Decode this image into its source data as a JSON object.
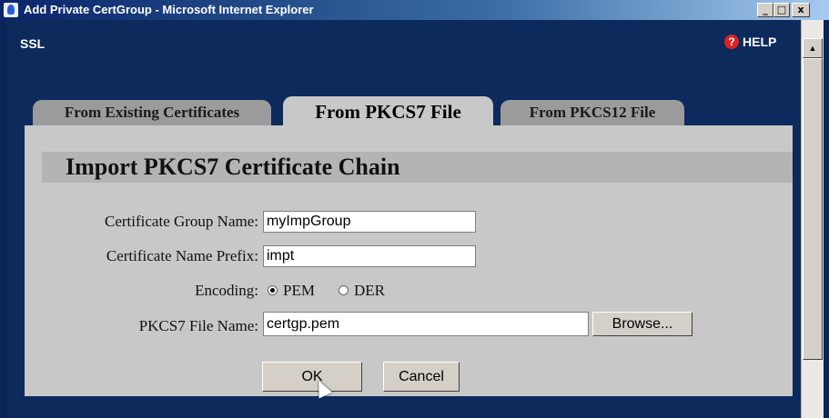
{
  "window": {
    "title": "Add Private CertGroup - Microsoft Internet Explorer",
    "controls": {
      "minimize": "_",
      "maximize": "□",
      "close": "x"
    }
  },
  "header": {
    "section": "SSL",
    "help": "HELP"
  },
  "tabs": [
    {
      "label": "From Existing Certificates",
      "active": false
    },
    {
      "label": "From PKCS7 File",
      "active": true
    },
    {
      "label": "From PKCS12 File",
      "active": false
    }
  ],
  "panel": {
    "title": "Import PKCS7 Certificate Chain",
    "fields": {
      "group_name": {
        "label": "Certificate Group Name:",
        "value": "myImpGroup"
      },
      "name_prefix": {
        "label": "Certificate Name Prefix:",
        "value": "impt"
      },
      "encoding": {
        "label": "Encoding:",
        "options": [
          "PEM",
          "DER"
        ],
        "selected": "PEM"
      },
      "file_name": {
        "label": "PKCS7 File Name:",
        "value": "certgp.pem",
        "browse": "Browse..."
      }
    },
    "buttons": {
      "ok": "OK",
      "cancel": "Cancel"
    }
  },
  "icons": {
    "help": "help-icon",
    "app": "ie-icon",
    "scroll_up": "scroll-up-arrow-icon"
  },
  "colors": {
    "background": "#0c2a5c",
    "panel": "#c8c8c8",
    "active_tab": "#c8c8c8",
    "inactive_tab": "#9b9b9b"
  }
}
